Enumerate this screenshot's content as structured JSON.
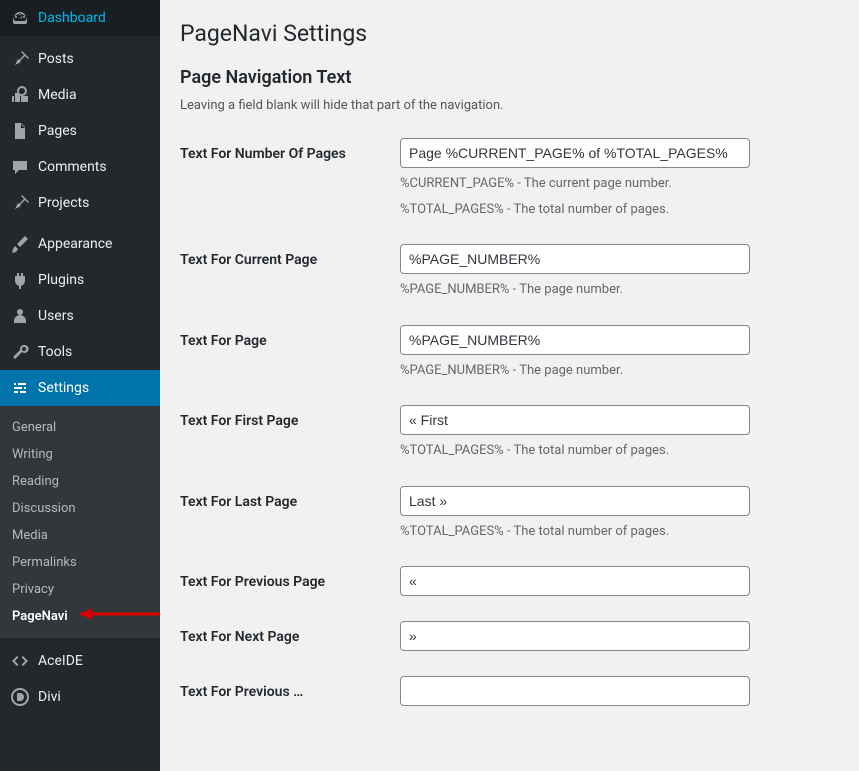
{
  "sidebar": {
    "items": [
      {
        "label": "Dashboard",
        "icon": "dashboard"
      },
      {
        "label": "Posts",
        "icon": "pin"
      },
      {
        "label": "Media",
        "icon": "media"
      },
      {
        "label": "Pages",
        "icon": "pages"
      },
      {
        "label": "Comments",
        "icon": "comments"
      },
      {
        "label": "Projects",
        "icon": "pin"
      },
      {
        "label": "Appearance",
        "icon": "brush"
      },
      {
        "label": "Plugins",
        "icon": "plug"
      },
      {
        "label": "Users",
        "icon": "users"
      },
      {
        "label": "Tools",
        "icon": "tools"
      },
      {
        "label": "Settings",
        "icon": "settings"
      },
      {
        "label": "AceIDE",
        "icon": "code"
      },
      {
        "label": "Divi",
        "icon": "divi"
      }
    ],
    "submenu": [
      {
        "label": "General"
      },
      {
        "label": "Writing"
      },
      {
        "label": "Reading"
      },
      {
        "label": "Discussion"
      },
      {
        "label": "Media"
      },
      {
        "label": "Permalinks"
      },
      {
        "label": "Privacy"
      },
      {
        "label": "PageNavi"
      }
    ]
  },
  "page": {
    "title": "PageNavi Settings",
    "section_title": "Page Navigation Text",
    "section_desc": "Leaving a field blank will hide that part of the navigation."
  },
  "fields": {
    "num_pages": {
      "label": "Text For Number Of Pages",
      "value": "Page %CURRENT_PAGE% of %TOTAL_PAGES%",
      "help1": "%CURRENT_PAGE% - The current page number.",
      "help2": "%TOTAL_PAGES% - The total number of pages."
    },
    "current_page": {
      "label": "Text For Current Page",
      "value": "%PAGE_NUMBER%",
      "help": "%PAGE_NUMBER% - The page number."
    },
    "page": {
      "label": "Text For Page",
      "value": "%PAGE_NUMBER%",
      "help": "%PAGE_NUMBER% - The page number."
    },
    "first_page": {
      "label": "Text For First Page",
      "value": "« First",
      "help": "%TOTAL_PAGES% - The total number of pages."
    },
    "last_page": {
      "label": "Text For Last Page",
      "value": "Last »",
      "help": "%TOTAL_PAGES% - The total number of pages."
    },
    "prev_page": {
      "label": "Text For Previous Page",
      "value": "«"
    },
    "next_page": {
      "label": "Text For Next Page",
      "value": "»"
    },
    "prev_dots": {
      "label": "Text For Previous …",
      "value": ""
    }
  }
}
